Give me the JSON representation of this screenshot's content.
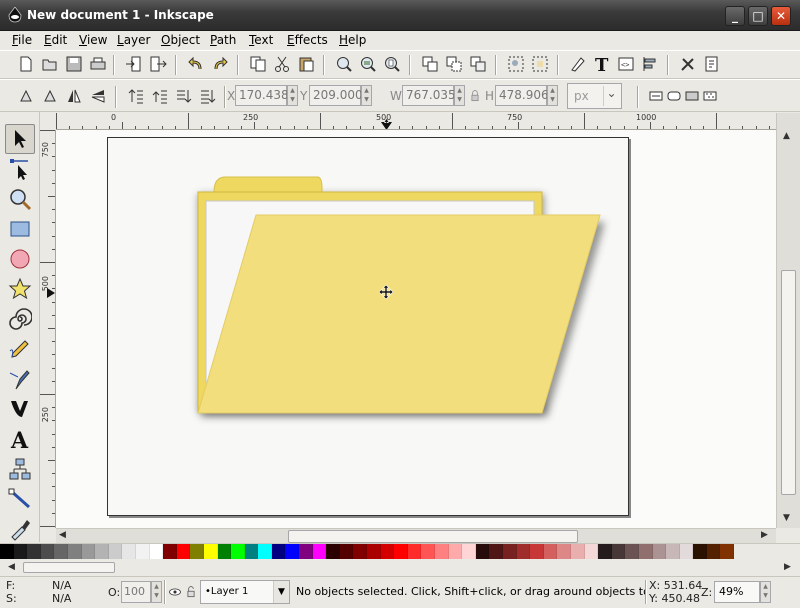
{
  "window": {
    "title": "New document 1 - Inkscape",
    "minimize_label": "_",
    "maximize_label": "□",
    "close_label": "✕"
  },
  "menu": [
    "File",
    "Edit",
    "View",
    "Layer",
    "Object",
    "Path",
    "Text",
    "Effects",
    "Help"
  ],
  "commands_toolbar": {
    "icons": [
      "new-document-icon",
      "open-icon",
      "save-icon",
      "print-icon",
      "import-icon",
      "export-icon",
      "undo-icon",
      "redo-icon",
      "copy-icon",
      "cut-icon",
      "paste-icon",
      "zoom-selection-icon",
      "zoom-drawing-icon",
      "zoom-page-icon",
      "duplicate-icon",
      "clone-icon",
      "unlink-clone-icon",
      "group-icon",
      "ungroup-icon",
      "fill-stroke-icon",
      "text-font-icon",
      "xml-editor-icon",
      "align-distribute-icon",
      "preferences-icon",
      "document-properties-icon"
    ]
  },
  "controls_toolbar": {
    "x_label": "X",
    "x_value": "170.438",
    "y_label": "Y",
    "y_value": "209.000",
    "w_label": "W",
    "w_value": "767.035",
    "lock_icon": "lock-icon",
    "h_label": "H",
    "h_value": "478.906",
    "unit": "px"
  },
  "rulers": {
    "horizontal_labels": [
      "0",
      "250",
      "500",
      "750",
      "1000"
    ],
    "vertical_labels": [
      "750",
      "500",
      "250"
    ]
  },
  "tools": [
    "selector-tool-icon",
    "node-tool-icon",
    "zoom-tool-icon",
    "rectangle-tool-icon",
    "ellipse-tool-icon",
    "star-tool-icon",
    "spiral-tool-icon",
    "pencil-tool-icon",
    "pen-tool-icon",
    "calligraphy-tool-icon",
    "text-tool-icon",
    "connector-tool-icon",
    "gradient-tool-icon",
    "dropper-tool-icon"
  ],
  "palette": [
    "#000000",
    "#1a1a1a",
    "#333333",
    "#4d4d4d",
    "#666666",
    "#808080",
    "#999999",
    "#b3b3b3",
    "#cccccc",
    "#e6e6e6",
    "#f2f2f2",
    "#ffffff",
    "#800000",
    "#ff0000",
    "#808000",
    "#ffff00",
    "#008000",
    "#00ff00",
    "#008080",
    "#00ffff",
    "#000080",
    "#0000ff",
    "#800080",
    "#ff00ff",
    "#2b0000",
    "#550000",
    "#800000",
    "#aa0000",
    "#d40000",
    "#ff0000",
    "#ff2a2a",
    "#ff5555",
    "#ff8080",
    "#ffaaaa",
    "#ffd5d5",
    "#280b0b",
    "#501616",
    "#782121",
    "#a02c2c",
    "#c83737",
    "#d35f5f",
    "#de8787",
    "#e9afaf",
    "#f4d7d7",
    "#241c1c",
    "#483737",
    "#6c5353",
    "#916f6f",
    "#ac9393",
    "#c8b7b7",
    "#e3dbdb",
    "#2b1100",
    "#552200",
    "#803300"
  ],
  "status": {
    "fill_label": "F:",
    "fill_value": "N/A",
    "stroke_label": "S:",
    "stroke_value": "N/A",
    "opacity_label": "O:",
    "opacity_value": "100",
    "layer": "•Layer 1",
    "message": "No objects selected. Click, Shift+click, or drag around objects to select.",
    "cursor_x": "X: 531.64",
    "cursor_y": "Y: 450.48",
    "zoom_label": "Z:",
    "zoom_value": "49%"
  },
  "colors": {
    "folder_fill": "#f3de7e",
    "folder_stroke": "#d6bf4a",
    "folder_tab": "#eed85f",
    "page_bg": "#f8f8f6"
  }
}
